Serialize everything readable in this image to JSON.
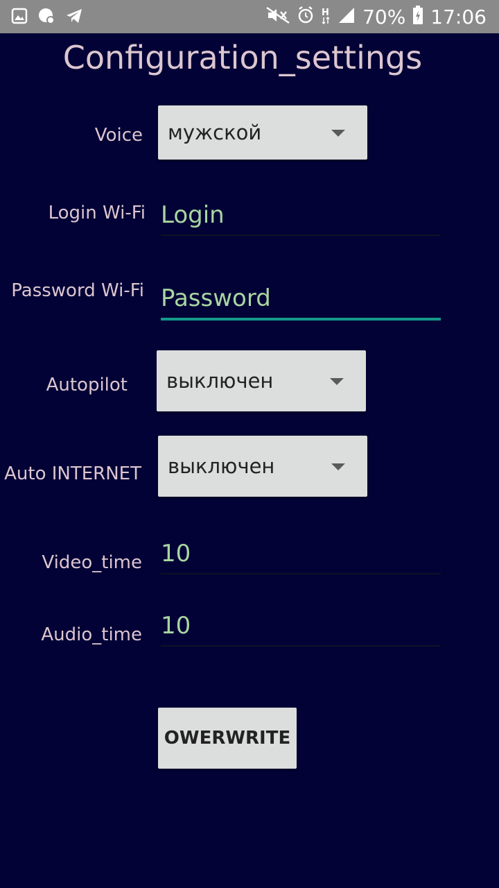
{
  "status_bar": {
    "battery": "70%",
    "time": "17:06",
    "network": "H",
    "icons_left": [
      "gallery-icon",
      "viber-icon",
      "telegram-icon"
    ],
    "icons_right": [
      "mute-icon",
      "alarm-icon",
      "network-type-icon",
      "signal-icon",
      "battery-icon"
    ]
  },
  "page": {
    "title": "Configuration_settings"
  },
  "form": {
    "voice": {
      "label": "Voice",
      "value": "мужской"
    },
    "login": {
      "label": "Login Wi-Fi",
      "placeholder": "Login",
      "value": ""
    },
    "password": {
      "label": "Password Wi-Fi",
      "placeholder": "Password",
      "value": ""
    },
    "autopilot": {
      "label": "Autopilot",
      "value": "выключен"
    },
    "auto_internet": {
      "label": "Auto INTERNET",
      "value": "выключен"
    },
    "video_time": {
      "label": "Video_time",
      "value": "10"
    },
    "audio_time": {
      "label": "Audio_time",
      "value": "10"
    }
  },
  "actions": {
    "overwrite_label": "OWERWRITE"
  },
  "colors": {
    "background": "#020236",
    "label_text": "#dcc6cf",
    "input_text": "#a9d6a1",
    "accent": "#14998a",
    "status_bar": "#8a8a8a",
    "spinner_bg": "#dcdedd"
  }
}
